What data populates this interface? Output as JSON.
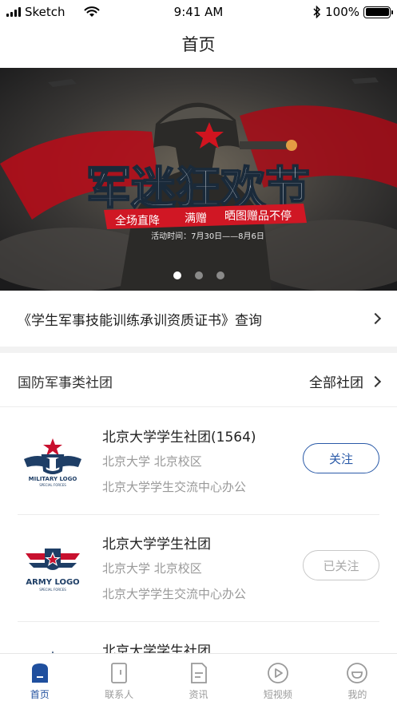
{
  "status_bar": {
    "carrier": "Sketch",
    "time": "9:41 AM",
    "battery": "100%"
  },
  "nav": {
    "title": "首页"
  },
  "banner": {
    "headline": "军迷狂欢节",
    "tags": [
      "全场直降",
      "满赠",
      "晒图赠品不停"
    ],
    "date_text": "活动时间：7月30日——8月6日",
    "page_count": 3,
    "active_index": 0
  },
  "cert": {
    "label": "《学生军事技能训练承训资质证书》查询"
  },
  "section": {
    "title": "国防军事类社团",
    "more_label": "全部社团"
  },
  "clubs": [
    {
      "name": "北京大学学生社团(1564)",
      "school": "北京大学 北京校区",
      "address": "北京大学学生交流中心办公",
      "button": "关注",
      "followed": false,
      "logo_text": "MILITARY LOGO",
      "logo_sub": "SPECIAL FORCES"
    },
    {
      "name": "北京大学学生社团",
      "school": "北京大学 北京校区",
      "address": "北京大学学生交流中心办公",
      "button": "已关注",
      "followed": true,
      "logo_text": "ARMY LOGO",
      "logo_sub": "SPECIAL FORCES"
    },
    {
      "name": "北京大学学生社团",
      "school": "",
      "address": "",
      "button": "",
      "followed": false,
      "logo_text": "",
      "logo_sub": ""
    }
  ],
  "tabs": [
    {
      "label": "首页",
      "icon": "home-icon",
      "active": true
    },
    {
      "label": "联系人",
      "icon": "contacts-icon",
      "active": false
    },
    {
      "label": "资讯",
      "icon": "news-icon",
      "active": false
    },
    {
      "label": "短视频",
      "icon": "video-icon",
      "active": false
    },
    {
      "label": "我的",
      "icon": "profile-icon",
      "active": false
    }
  ],
  "colors": {
    "accent": "#1f4f9e",
    "banner_red": "#c8102e",
    "gray_text": "#999999"
  }
}
